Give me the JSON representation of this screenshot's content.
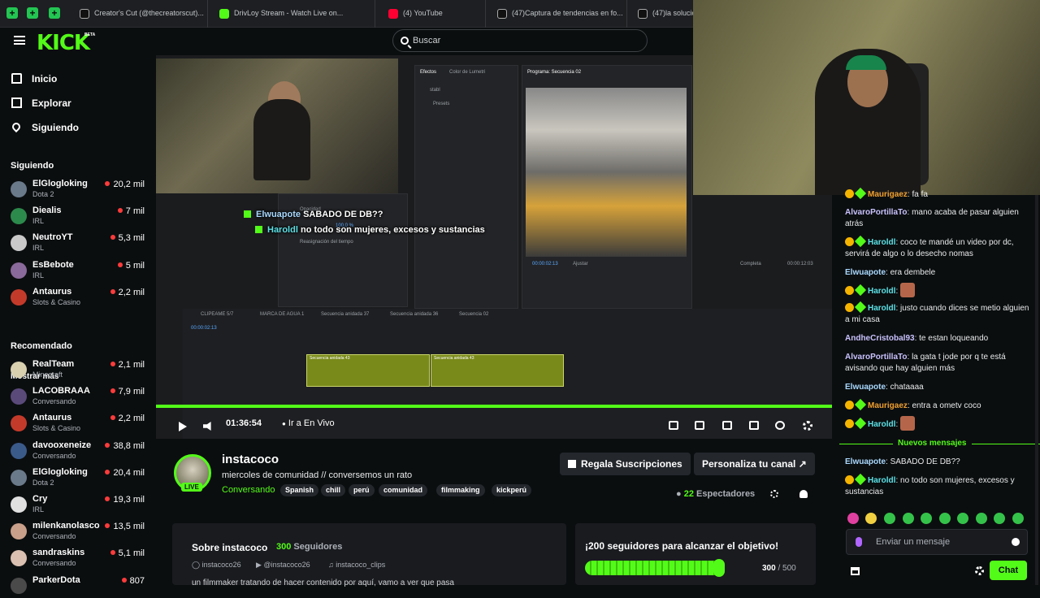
{
  "browser_tabs": [
    {
      "label": "Creator's Cut (@thecreatorscut)...",
      "icon": "tiktok-icon"
    },
    {
      "label": "DrivLoy Stream - Watch Live on...",
      "icon": "kick-icon"
    },
    {
      "label": "(4) YouTube",
      "icon": "youtube-icon"
    },
    {
      "label": "(47)Captura de tendencias en fo...",
      "icon": "tiktok-icon"
    },
    {
      "label": "(47)la solució",
      "icon": "tiktok-icon"
    }
  ],
  "header": {
    "logo": "KICK",
    "beta": "BETA",
    "search_placeholder": "Buscar"
  },
  "nav": [
    {
      "label": "Inicio",
      "icon": "home-icon"
    },
    {
      "label": "Explorar",
      "icon": "compass-icon"
    },
    {
      "label": "Siguiendo",
      "icon": "heart-icon"
    }
  ],
  "sidebar": {
    "following_title": "Siguiendo",
    "following": [
      {
        "name": "ElGlogloking",
        "category": "Dota 2",
        "viewers": "20,2 mil",
        "color": "#6a7a8a"
      },
      {
        "name": "Diealis",
        "category": "IRL",
        "viewers": "7 mil",
        "color": "#2c8a4c"
      },
      {
        "name": "NeutroYT",
        "category": "IRL",
        "viewers": "5,3 mil",
        "color": "#c9c9c9"
      },
      {
        "name": "EsBebote",
        "category": "IRL",
        "viewers": "5 mil",
        "color": "#8a6a9a"
      },
      {
        "name": "Antaurus",
        "category": "Slots & Casino",
        "viewers": "2,2 mil",
        "color": "#c43a2a"
      }
    ],
    "show_more": "Mostrar más",
    "recommended_title": "Recomendado",
    "recommended": [
      {
        "name": "RealTeam",
        "category": "Minecraft",
        "viewers": "2,1 mil",
        "color": "#d9d0b0"
      },
      {
        "name": "LACOBRAAA",
        "category": "Conversando",
        "viewers": "7,9 mil",
        "color": "#5a4a7a"
      },
      {
        "name": "Antaurus",
        "category": "Slots & Casino",
        "viewers": "2,2 mil",
        "color": "#c43a2a"
      },
      {
        "name": "davooxeneize",
        "category": "Conversando",
        "viewers": "38,8 mil",
        "color": "#3a5a8a"
      },
      {
        "name": "ElGlogloking",
        "category": "Dota 2",
        "viewers": "20,4 mil",
        "color": "#6a7a8a"
      },
      {
        "name": "Cry",
        "category": "IRL",
        "viewers": "19,3 mil",
        "color": "#e0e0e0"
      },
      {
        "name": "milenkanolasco",
        "category": "Conversando",
        "viewers": "13,5 mil",
        "color": "#c9a08a"
      },
      {
        "name": "sandraskins",
        "category": "Conversando",
        "viewers": "5,1 mil",
        "color": "#d9c0b0"
      },
      {
        "name": "ParkerDota",
        "category": "",
        "viewers": "807",
        "color": "#4a4a4a"
      }
    ]
  },
  "video": {
    "overlay_chat": [
      {
        "user": "Elwuapote",
        "text": "SABADO DE DB??"
      },
      {
        "user": "Haroldl",
        "text": "no todo son mujeres, excesos y sustancias"
      }
    ],
    "editor_labels": {
      "effects": "Efectos",
      "lumetri": "Color de Lumetri",
      "program": "Programa: Secuencia 02",
      "search": "stabl",
      "presets": "Presets",
      "timecode_left": "00:00:02:13",
      "timecode_right": "00:00:12:03",
      "ajustar": "Ajustar",
      "completa": "Completa",
      "seq_tabs": [
        "CLIPEAME 5/7",
        "MARCA DE AGUA 1",
        "Secuencia anidada 37",
        "Secuencia anidada 36",
        "Secuencia 02"
      ],
      "clip": "Secuencia anidada 43",
      "opacity": "Opacidad",
      "opacity_value": "100,0 %",
      "time_remap": "Reasignación del tiempo"
    },
    "time": "01:36:54",
    "go_live": "Ir a En Vivo",
    "progress_pct": 100
  },
  "channel": {
    "name": "instacoco",
    "live": "LIVE",
    "title": "miercoles de comunidad // conversemos un rato",
    "category": "Conversando",
    "tags": [
      "Spanish",
      "chill",
      "perú",
      "comunidad",
      "filmmaking",
      "kickperú"
    ],
    "gift_button": "Regala Suscripciones",
    "customize_button": "Personaliza tu canal",
    "viewers": "22",
    "viewers_label": "Espectadores"
  },
  "about": {
    "title": "Sobre instacoco",
    "followers": "300",
    "followers_label": "Seguidores",
    "socials": [
      {
        "icon": "instagram-icon",
        "handle": "instacoco26"
      },
      {
        "icon": "youtube-icon",
        "handle": "@instacoco26"
      },
      {
        "icon": "tiktok-icon",
        "handle": "instacoco_clips"
      }
    ],
    "description": "un filmmaker tratando de hacer contenido por aquí, vamo a ver que pasa"
  },
  "goal": {
    "title": "¡200 seguidores para alcanzar el objetivo!",
    "current": "300",
    "total": "/ 500",
    "fraction": 0.6
  },
  "chat": {
    "messages": [
      {
        "user": "Maurigaez",
        "text": "fa fa",
        "color": "#f0a030",
        "badges": true
      },
      {
        "user": "AlvaroPortillaTo",
        "text": "mano acaba de pasar alguien atrás",
        "color": "#c9c2ff",
        "badges": false
      },
      {
        "user": "Haroldl",
        "text": "coco te mandé un video por dc, servirá de algo o lo desecho nomas",
        "color": "#5ce1e6",
        "badges": true
      },
      {
        "user": "Elwuapote",
        "text": "era dembele",
        "color": "#a9d9ff",
        "badges": false
      },
      {
        "user": "Haroldl",
        "text": "",
        "color": "#5ce1e6",
        "badges": true,
        "emote": true
      },
      {
        "user": "Haroldl",
        "text": "justo cuando dices se metio alguien a mi casa",
        "color": "#5ce1e6",
        "badges": true
      },
      {
        "user": "AndheCristobal93",
        "text": "te estan loqueando",
        "color": "#c9c2ff",
        "badges": false
      },
      {
        "user": "AlvaroPortillaTo",
        "text": "la gata t jode por q te está avisando que hay alguien más",
        "color": "#c9c2ff",
        "badges": false
      },
      {
        "user": "Elwuapote",
        "text": "chataaaa",
        "color": "#a9d9ff",
        "badges": false
      },
      {
        "user": "Maurigaez",
        "text": "entra a ometv coco",
        "color": "#f0a030",
        "badges": true
      },
      {
        "user": "Haroldl",
        "text": "",
        "color": "#5ce1e6",
        "badges": true,
        "emote": true
      }
    ],
    "new_messages_label": "Nuevos mensajes",
    "new_messages": [
      {
        "user": "Elwuapote",
        "text": "SABADO DE DB??",
        "color": "#a9d9ff",
        "badges": false
      },
      {
        "user": "Haroldl",
        "text": "no todo son mujeres, excesos y sustancias",
        "color": "#5ce1e6",
        "badges": true
      }
    ],
    "input_placeholder": "Enviar un mensaje",
    "send_button": "Chat"
  }
}
